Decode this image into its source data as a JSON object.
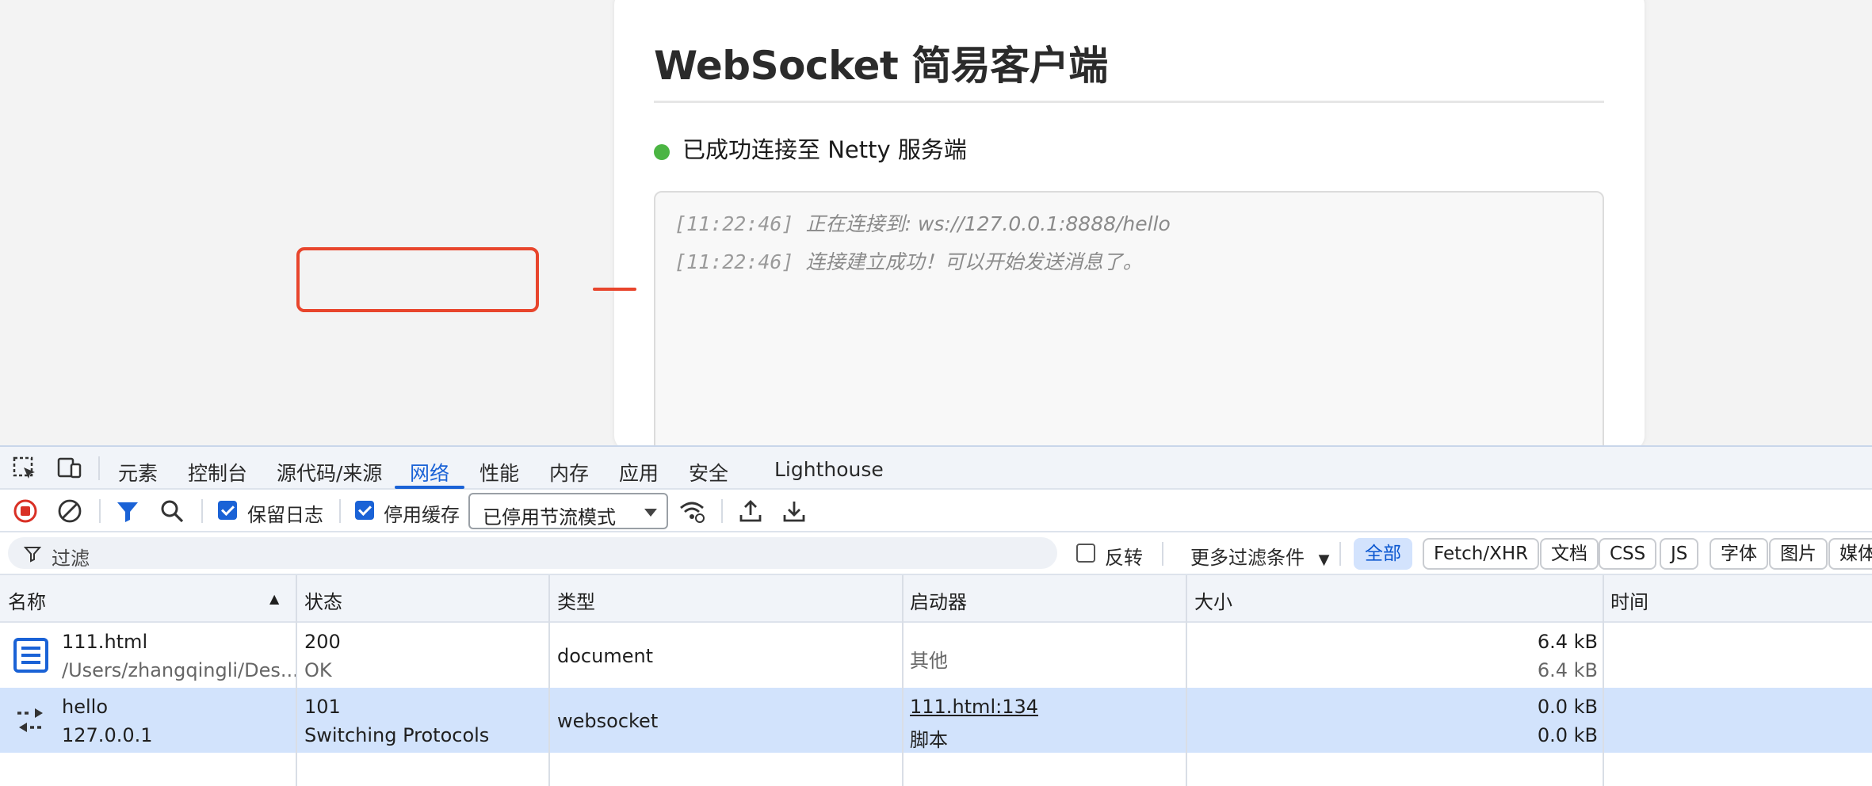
{
  "page": {
    "title": "WebSocket 简易客户端",
    "status_text": "已成功连接至 Netty 服务端",
    "status_color": "#4bb543",
    "log": [
      {
        "time": "[11:22:46]",
        "message": "正在连接到: ws://127.0.0.1:8888/hello"
      },
      {
        "time": "[11:22:46]",
        "message": "连接建立成功！可以开始发送消息了。"
      }
    ]
  },
  "devtools": {
    "tabs": [
      "元素",
      "控制台",
      "源代码/来源",
      "网络",
      "性能",
      "内存",
      "应用",
      "安全",
      "Lighthouse"
    ],
    "active_tab": "网络",
    "accent_color": "#1a62d6",
    "toolbar": {
      "preserve_log_label": "保留日志",
      "disable_cache_label": "停用缓存",
      "throttle_value": "已停用节流模式"
    },
    "filter": {
      "placeholder": "过滤",
      "invert_label": "反转",
      "more_filters_label": "更多过滤条件",
      "chips": [
        "全部",
        "Fetch/XHR",
        "文档",
        "CSS",
        "JS",
        "字体",
        "图片",
        "媒体"
      ]
    },
    "columns": [
      "名称",
      "状态",
      "类型",
      "启动器",
      "大小",
      "时间"
    ],
    "rows": [
      {
        "icon": "document-icon",
        "name": "111.html",
        "path": "/Users/zhangqingli/Des...",
        "status_code": "200",
        "status_text": "OK",
        "type": "document",
        "initiator": "其他",
        "initiator_sub": "",
        "size_transferred": "6.4 kB",
        "size_resource": "6.4 kB"
      },
      {
        "icon": "websocket-icon",
        "name": "hello",
        "path": "127.0.0.1",
        "status_code": "101",
        "status_text": "Switching Protocols",
        "type": "websocket",
        "initiator": "111.html:134",
        "initiator_sub": "脚本",
        "size_transferred": "0.0 kB",
        "size_resource": "0.0 kB"
      }
    ]
  }
}
